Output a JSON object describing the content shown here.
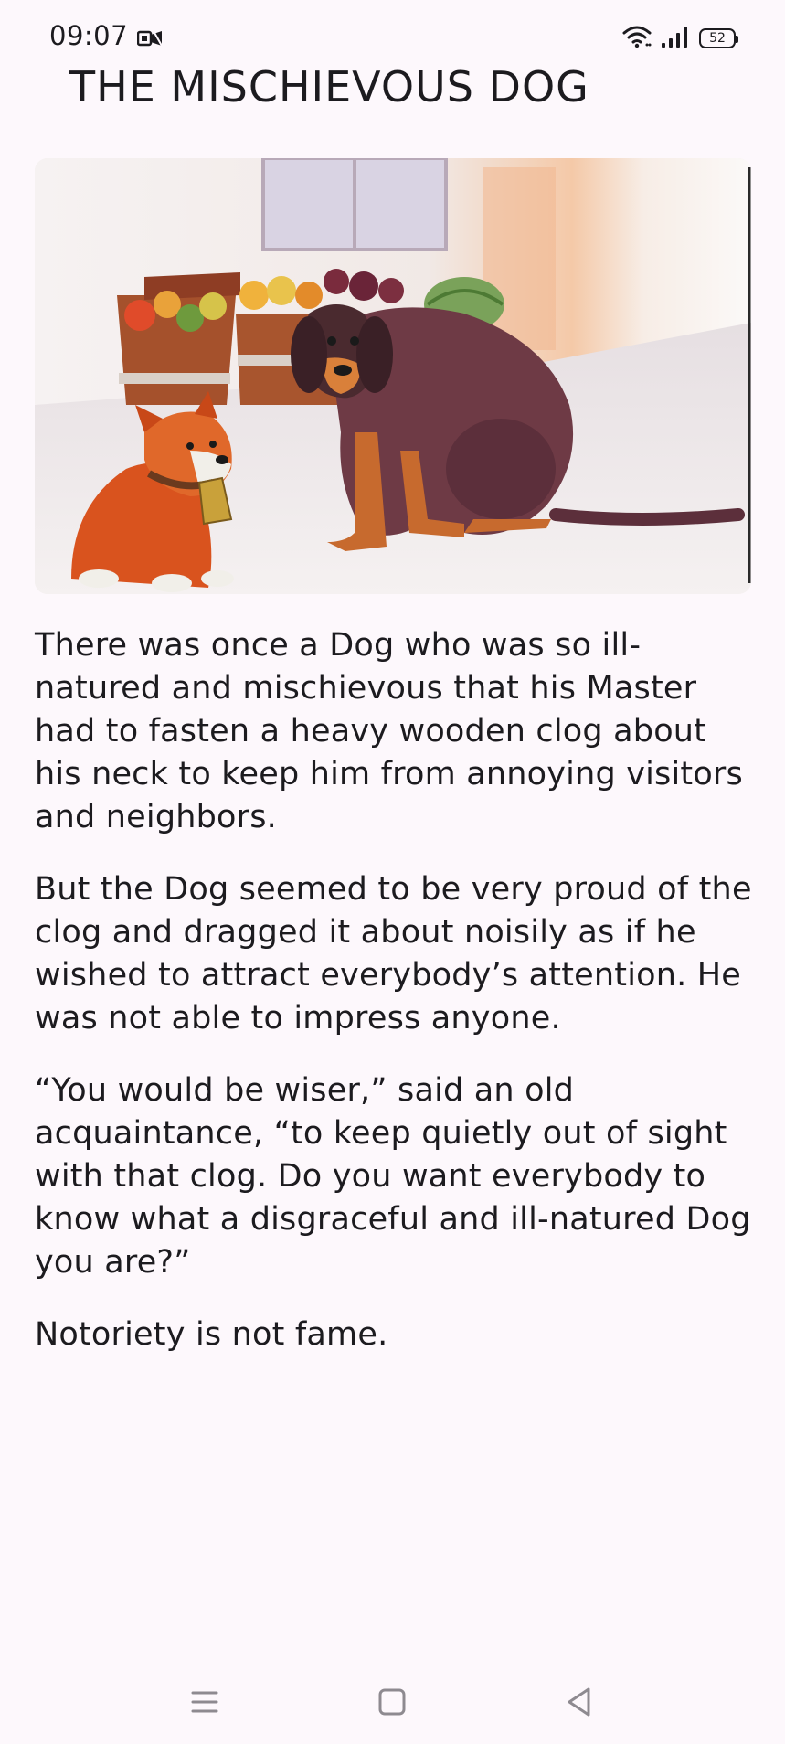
{
  "status_bar": {
    "time": "09:07",
    "battery": "52",
    "icons": [
      "notification-icon",
      "wifi-icon",
      "signal-icon",
      "battery-icon"
    ]
  },
  "title": "THE MISCHIEVOUS DOG",
  "illustration": {
    "icon": "dogs-illustration"
  },
  "paragraphs": [
    "There was once a Dog who was so ill-natured and mischievous that his Master had to fasten a heavy wooden clog about his neck to keep him from annoying visitors and neighbors.",
    "But the Dog seemed to be very proud of the clog and dragged it about noisily as if he wished to attract everybody’s attention. He was not able to impress anyone.",
    "“You would be wiser,” said an old acquaintance, “to keep quietly out of sight with that clog. Do you want everybody to know what a disgraceful and ill-natured Dog you are?”",
    "Notoriety is not fame."
  ],
  "nav_bar": {
    "icons": [
      "menu-icon",
      "home-icon",
      "back-icon"
    ]
  },
  "colors": {
    "background": "#fdf8fc",
    "text": "#1c1b1f"
  }
}
